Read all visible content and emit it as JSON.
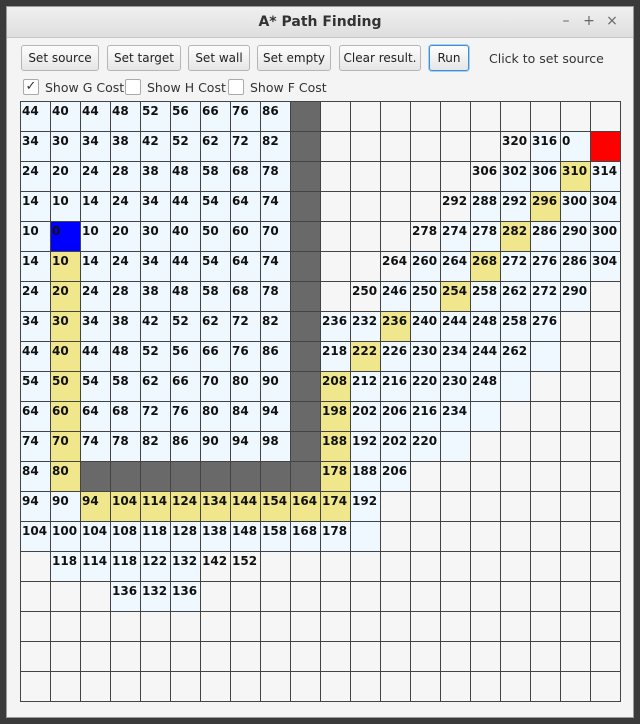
{
  "window": {
    "title": "A* Path Finding",
    "minimize": "–",
    "maximize": "+",
    "close": "×"
  },
  "toolbar": {
    "set_source": "Set source",
    "set_target": "Set target",
    "set_wall": "Set wall",
    "set_empty": "Set empty",
    "clear_result": "Clear result.",
    "run": "Run"
  },
  "status": "Click to set source",
  "options": {
    "show_g": {
      "label": "Show G Cost",
      "checked": true,
      "mark": "✓"
    },
    "show_h": {
      "label": "Show H Cost",
      "checked": false,
      "mark": ""
    },
    "show_f": {
      "label": "Show F Cost",
      "checked": false,
      "mark": ""
    }
  },
  "colors": {
    "empty": "#f6f6f6",
    "visited": "#f0f8ff",
    "path": "#f0e68c",
    "wall": "#696969",
    "source": "#0000ff",
    "target": "#ff0000"
  },
  "grid": {
    "rows": 20,
    "cols": 20,
    "cell_types": [
      "vvvvvvvvvw..........",
      "vvvvvvvvvw.......vvT",
      "vvvvvvvvvw......vvpv",
      "vvvvvvvvvw.....vvpvv",
      "vSvvvvvvvw....vvpvvv",
      "vpvvvvvvvw...vvpvvvv",
      "vpvvvvvvvw..vvpvvvv.",
      "vpvvvvvvvwvvpvvvvv..",
      "vpvvvvvvvwvpvvvvvv..",
      "vpvvvvvvvwpvvvvvv...",
      "vpvvvvvvvwpvvvvv....",
      "vpvvvvvvvwpvvvv.....",
      "vpwwwwwwwwpvv.......",
      "vvpppppppppv........",
      "vvvvvvvvvvvv........",
      ".vvvvv..............",
      "...vvv..............",
      "....................",
      "....................",
      "...................."
    ],
    "values": [
      [
        "44",
        "40",
        "44",
        "48",
        "52",
        "56",
        "66",
        "76",
        "86",
        "",
        "",
        "",
        "",
        "",
        "",
        "",
        "",
        "",
        "",
        ""
      ],
      [
        "34",
        "30",
        "34",
        "38",
        "42",
        "52",
        "62",
        "72",
        "82",
        "",
        "",
        "",
        "",
        "",
        "",
        "",
        "320",
        "316",
        "0",
        ""
      ],
      [
        "24",
        "20",
        "24",
        "28",
        "38",
        "48",
        "58",
        "68",
        "78",
        "",
        "",
        "",
        "",
        "",
        "",
        "306",
        "302",
        "306",
        "310",
        "314"
      ],
      [
        "14",
        "10",
        "14",
        "24",
        "34",
        "44",
        "54",
        "64",
        "74",
        "",
        "",
        "",
        "",
        "",
        "292",
        "288",
        "292",
        "296",
        "300",
        "304"
      ],
      [
        "10",
        "0",
        "10",
        "20",
        "30",
        "40",
        "50",
        "60",
        "70",
        "",
        "",
        "",
        "",
        "278",
        "274",
        "278",
        "282",
        "286",
        "290",
        "300"
      ],
      [
        "14",
        "10",
        "14",
        "24",
        "34",
        "44",
        "54",
        "64",
        "74",
        "",
        "",
        "",
        "264",
        "260",
        "264",
        "268",
        "272",
        "276",
        "286",
        "304"
      ],
      [
        "24",
        "20",
        "24",
        "28",
        "38",
        "48",
        "58",
        "68",
        "78",
        "",
        "",
        "250",
        "246",
        "250",
        "254",
        "258",
        "262",
        "272",
        "290",
        ""
      ],
      [
        "34",
        "30",
        "34",
        "38",
        "42",
        "52",
        "62",
        "72",
        "82",
        "",
        "236",
        "232",
        "236",
        "240",
        "244",
        "248",
        "258",
        "276",
        "",
        ""
      ],
      [
        "44",
        "40",
        "44",
        "48",
        "52",
        "56",
        "66",
        "76",
        "86",
        "",
        "218",
        "222",
        "226",
        "230",
        "234",
        "244",
        "262",
        "",
        "",
        ""
      ],
      [
        "54",
        "50",
        "54",
        "58",
        "62",
        "66",
        "70",
        "80",
        "90",
        "",
        "208",
        "212",
        "216",
        "220",
        "230",
        "248",
        "",
        "",
        "",
        ""
      ],
      [
        "64",
        "60",
        "64",
        "68",
        "72",
        "76",
        "80",
        "84",
        "94",
        "",
        "198",
        "202",
        "206",
        "216",
        "234",
        "",
        "",
        "",
        "",
        ""
      ],
      [
        "74",
        "70",
        "74",
        "78",
        "82",
        "86",
        "90",
        "94",
        "98",
        "",
        "188",
        "192",
        "202",
        "220",
        "",
        "",
        "",
        "",
        "",
        ""
      ],
      [
        "84",
        "80",
        "",
        "",
        "",
        "",
        "",
        "",
        "",
        "",
        "178",
        "188",
        "206",
        "",
        "",
        "",
        "",
        "",
        "",
        ""
      ],
      [
        "94",
        "90",
        "94",
        "104",
        "114",
        "124",
        "134",
        "144",
        "154",
        "164",
        "174",
        "192",
        "",
        "",
        "",
        "",
        "",
        "",
        "",
        ""
      ],
      [
        "104",
        "100",
        "104",
        "108",
        "118",
        "128",
        "138",
        "148",
        "158",
        "168",
        "178",
        "",
        "",
        "",
        "",
        "",
        "",
        "",
        "",
        ""
      ],
      [
        "",
        "118",
        "114",
        "118",
        "122",
        "132",
        "142",
        "152",
        "",
        "",
        "",
        "",
        "",
        "",
        "",
        "",
        "",
        "",
        "",
        ""
      ],
      [
        "",
        "",
        "",
        "136",
        "132",
        "136",
        "",
        "",
        "",
        "",
        "",
        "",
        "",
        "",
        "",
        "",
        "",
        "",
        "",
        ""
      ],
      [
        "",
        "",
        "",
        "",
        "",
        "",
        "",
        "",
        "",
        "",
        "",
        "",
        "",
        "",
        "",
        "",
        "",
        "",
        "",
        ""
      ],
      [
        "",
        "",
        "",
        "",
        "",
        "",
        "",
        "",
        "",
        "",
        "",
        "",
        "",
        "",
        "",
        "",
        "",
        "",
        "",
        ""
      ],
      [
        "",
        "",
        "",
        "",
        "",
        "",
        "",
        "",
        "",
        "",
        "",
        "",
        "",
        "",
        "",
        "",
        "",
        "",
        "",
        ""
      ]
    ]
  }
}
